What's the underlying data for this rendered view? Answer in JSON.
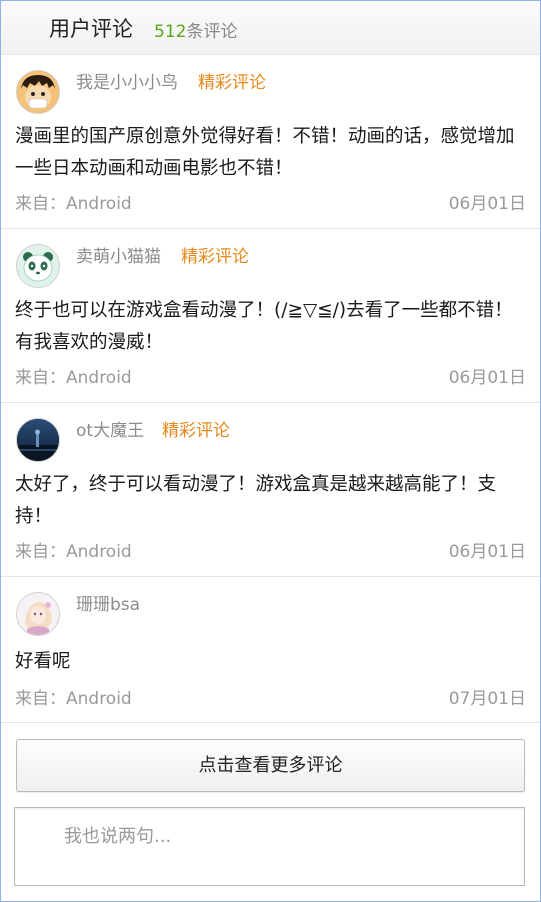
{
  "header": {
    "title": "用户评论",
    "count_number": "512",
    "count_suffix": "条评论"
  },
  "comments": [
    {
      "username": "我是小小小鸟",
      "badge": "精彩评论",
      "content": "漫画里的国产原创意外觉得好看！不错！动画的话，感觉增加一些日本动画和动画电影也不错！",
      "source": "来自：Android",
      "date": "06月01日"
    },
    {
      "username": "卖萌小猫猫",
      "badge": "精彩评论",
      "content": "终于也可以在游戏盒看动漫了！(/≧▽≦/)去看了一些都不错！有我喜欢的漫威！",
      "source": "来自：Android",
      "date": "06月01日"
    },
    {
      "username": "ot大魔王",
      "badge": "精彩评论",
      "content": "太好了，终于可以看动漫了！游戏盒真是越来越高能了！支持！",
      "source": "来自：Android",
      "date": "06月01日"
    },
    {
      "username": "珊珊bsa",
      "badge": "",
      "content": "好看呢",
      "source": "来自：Android",
      "date": "07月01日"
    }
  ],
  "more_button": {
    "label": "点击查看更多评论"
  },
  "comment_input": {
    "placeholder": "我也说两句..."
  },
  "colors": {
    "badge": "#e8881a",
    "count_number": "#5aa51d",
    "meta_text": "#9a9a9a"
  },
  "icons": {
    "avatar_1": "cartoon-boy-avatar",
    "avatar_2": "panda-avatar",
    "avatar_3": "night-landscape-avatar",
    "avatar_4": "anime-girl-avatar"
  }
}
